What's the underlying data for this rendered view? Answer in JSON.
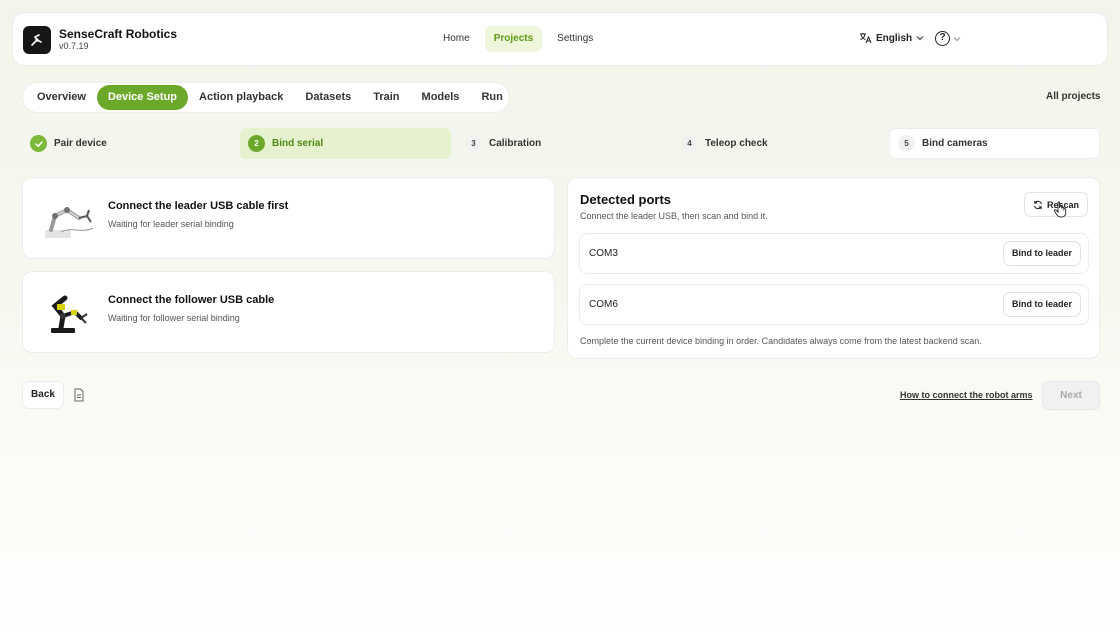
{
  "app": {
    "name": "SenseCraft Robotics",
    "version": "v0.7.19"
  },
  "nav": {
    "items": [
      {
        "label": "Home",
        "active": false
      },
      {
        "label": "Projects",
        "active": true
      },
      {
        "label": "Settings",
        "active": false
      }
    ]
  },
  "language": {
    "label": "English",
    "icon": "translate-icon"
  },
  "help": {
    "icon": "help-circle-icon",
    "glyph": "?"
  },
  "tabs": [
    {
      "label": "Overview",
      "active": false
    },
    {
      "label": "Device Setup",
      "active": true
    },
    {
      "label": "Action playback",
      "active": false
    },
    {
      "label": "Datasets",
      "active": false
    },
    {
      "label": "Train",
      "active": false
    },
    {
      "label": "Models",
      "active": false
    },
    {
      "label": "Run",
      "active": false
    }
  ],
  "all_projects": "All projects",
  "steps": [
    {
      "number": "",
      "label": "Pair device",
      "state": "done"
    },
    {
      "number": "2",
      "label": "Bind serial",
      "state": "current"
    },
    {
      "number": "3",
      "label": "Calibration",
      "state": "pending"
    },
    {
      "number": "4",
      "label": "Teleop check",
      "state": "pending"
    },
    {
      "number": "5",
      "label": "Bind cameras",
      "state": "pending"
    }
  ],
  "devices": [
    {
      "title": "Connect the leader USB cable first",
      "status": "Waiting for leader serial binding"
    },
    {
      "title": "Connect the follower USB cable",
      "status": "Waiting for follower serial binding"
    }
  ],
  "ports": {
    "title": "Detected ports",
    "subtitle": "Connect the leader USB, then scan and bind it.",
    "rescan_label": "Rescan",
    "list": [
      {
        "name": "COM3",
        "action": "Bind to leader"
      },
      {
        "name": "COM6",
        "action": "Bind to leader"
      }
    ],
    "footer": "Complete the current device binding in order. Candidates always come from the latest backend scan."
  },
  "footer": {
    "back_label": "Back",
    "help_link": "How to connect the robot arms",
    "next_label": "Next"
  },
  "colors": {
    "accent": "#6ca92a",
    "accent_soft": "#e6f1cf",
    "nav_active_text": "#5e9c13"
  }
}
